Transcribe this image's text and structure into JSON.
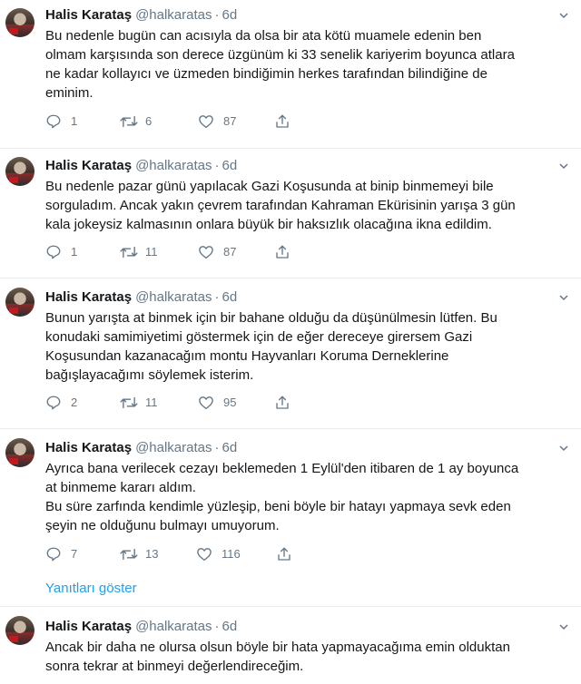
{
  "tweets": [
    {
      "name": "Halis Karataş",
      "handle": "@halkaratas",
      "time": "6d",
      "lines": [
        "Bu nedenle bugün can acısıyla da olsa bir ata kötü muamele edenin ben",
        "olmam karşısında son derece üzgünüm ki 33 senelik kariyerim boyunca atlara",
        "ne kadar kollayıcı ve üzmeden bindiğimin herkes tarafından bilindiğine de",
        "eminim."
      ],
      "replies": "1",
      "retweets": "6",
      "likes": "87"
    },
    {
      "name": "Halis Karataş",
      "handle": "@halkaratas",
      "time": "6d",
      "lines": [
        "Bu nedenle pazar günü yapılacak Gazi Koşusunda at binip binmemeyi bile",
        "sorguladım.  Ancak yakın çevrem tarafından  Kahraman Ekürisinin yarışa 3 gün",
        "kala jokeysiz kalmasının onlara büyük bir haksızlık olacağına ikna edildim."
      ],
      "replies": "1",
      "retweets": "11",
      "likes": "87"
    },
    {
      "name": "Halis Karataş",
      "handle": "@halkaratas",
      "time": "6d",
      "lines": [
        "Bunun yarışta at binmek için bir bahane olduğu da düşünülmesin lütfen. Bu",
        "konudaki samimiyetimi göstermek için de eğer dereceye girersem Gazi",
        "Koşusundan kazanacağım montu Hayvanları Koruma Derneklerine",
        "bağışlayacağımı söylemek isterim."
      ],
      "replies": "2",
      "retweets": "11",
      "likes": "95"
    },
    {
      "name": "Halis Karataş",
      "handle": "@halkaratas",
      "time": "6d",
      "lines": [
        "Ayrıca bana verilecek cezayı beklemeden 1 Eylül'den itibaren de 1 ay boyunca",
        "at binmeme kararı aldım.",
        "Bu süre zarfında kendimle yüzleşip, beni böyle bir hatayı yapmaya sevk eden",
        "şeyin ne olduğunu bulmayı umuyorum."
      ],
      "replies": "7",
      "retweets": "13",
      "likes": "116"
    },
    {
      "name": "Halis Karataş",
      "handle": "@halkaratas",
      "time": "6d",
      "lines": [
        "Ancak bir daha ne olursa olsun böyle bir hata yapmayacağıma emin olduktan",
        "sonra tekrar at binmeyi değerlendireceğim."
      ]
    }
  ],
  "show_replies_label": "Yanıtları göster",
  "colors": {
    "text": "#14171a",
    "secondary": "#657786",
    "link": "#1da1f2",
    "divider": "#e6ecf0"
  },
  "icons": [
    "reply-icon",
    "retweet-icon",
    "like-icon",
    "share-icon",
    "chevron-down-icon"
  ]
}
